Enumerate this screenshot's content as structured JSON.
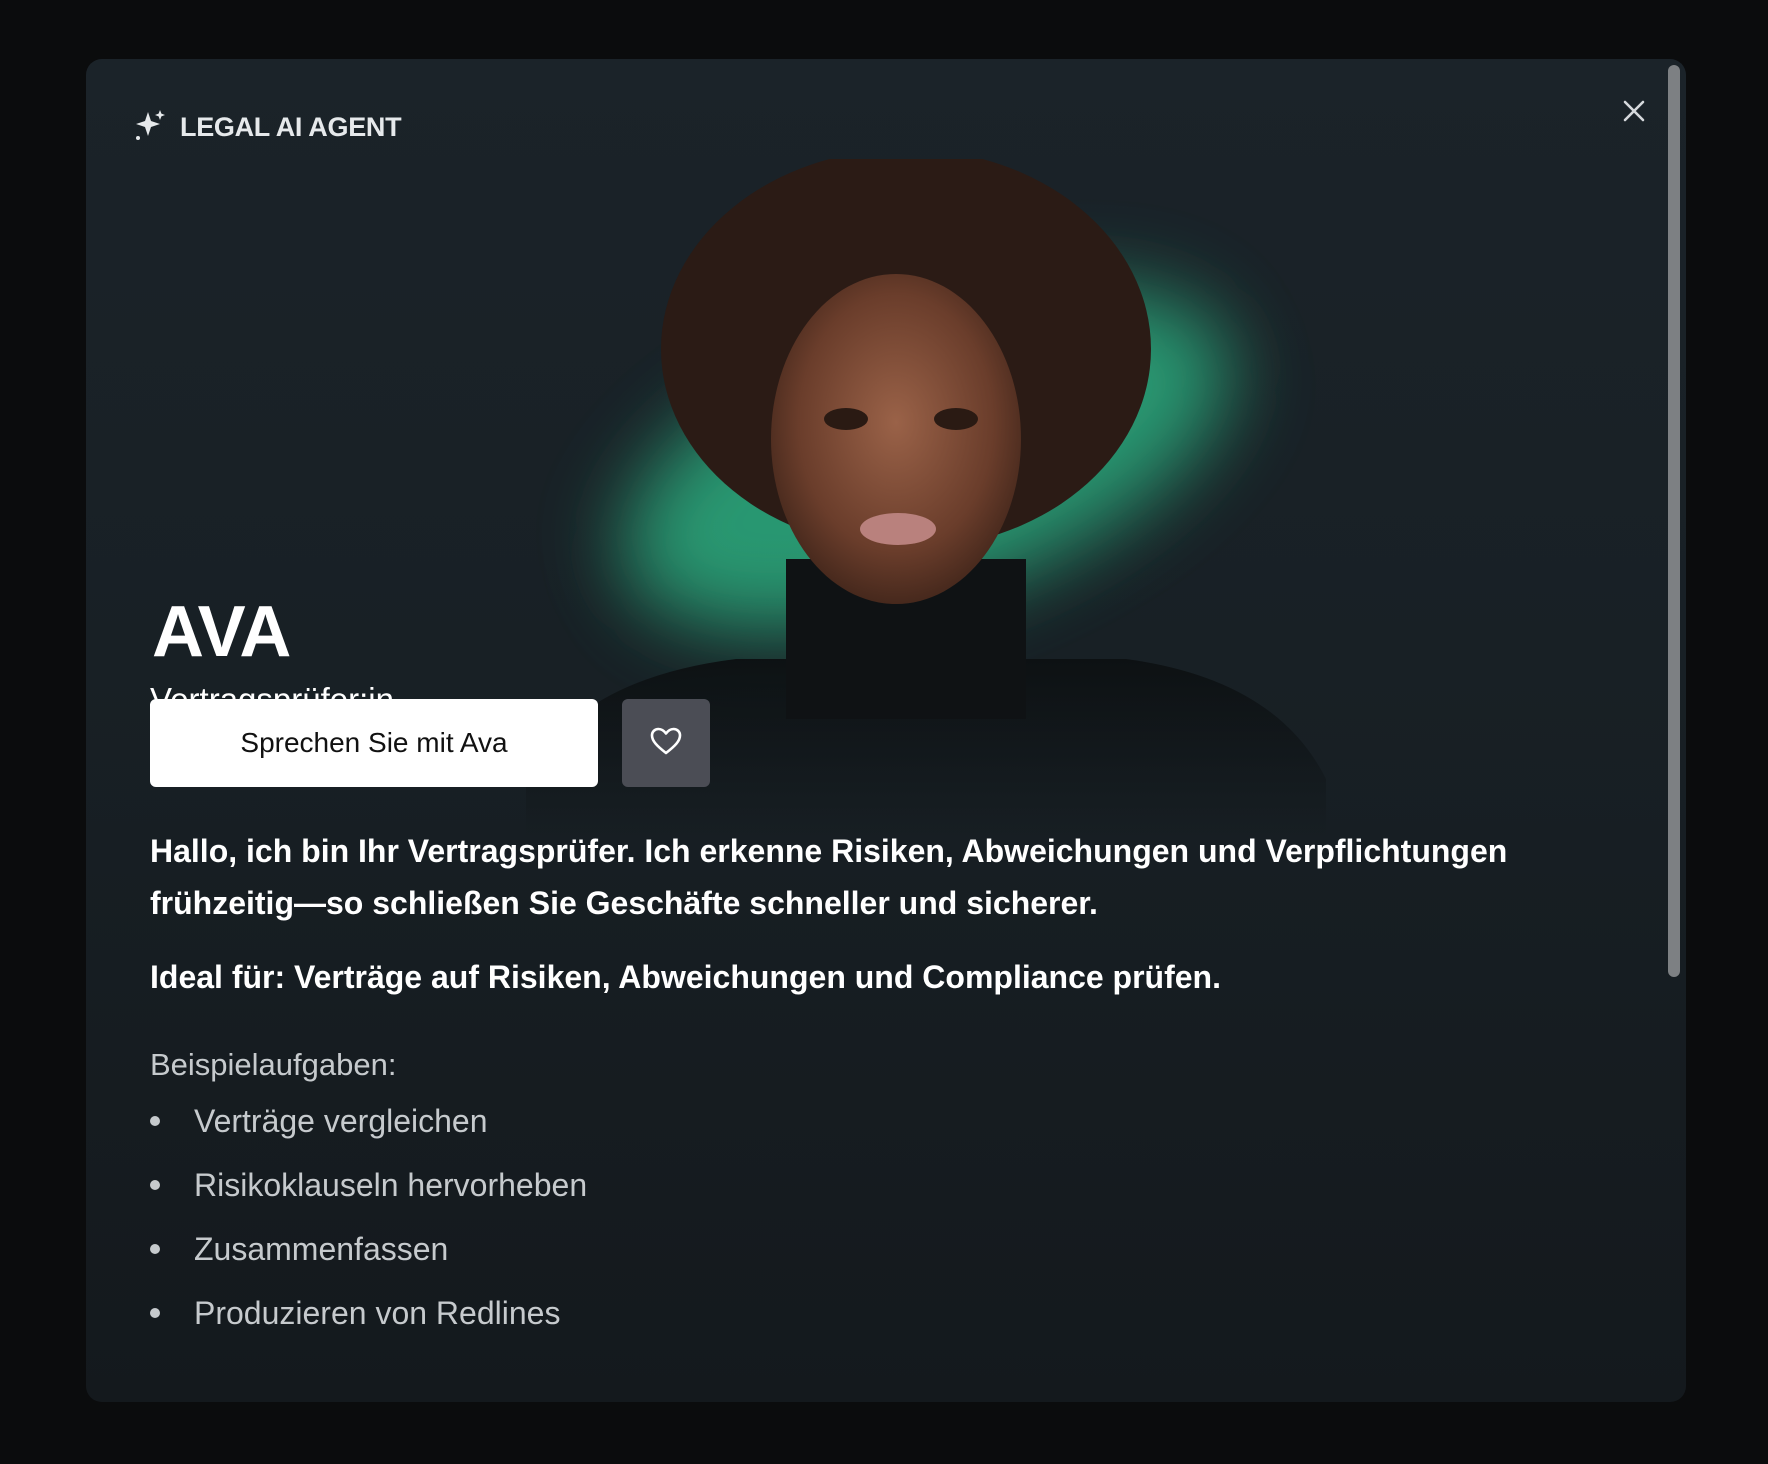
{
  "header": {
    "badge_label": "LEGAL AI AGENT"
  },
  "agent": {
    "name": "AVA",
    "role": "Vertragsprüfer:in",
    "cta_label": "Sprechen Sie mit Ava",
    "intro": "Hallo, ich bin Ihr Vertragsprüfer. Ich erkenne Risiken, Abweichungen und Verpflichtungen frühzeitig—so schließen Sie Geschäfte schneller und sicherer.",
    "ideal_for": "Ideal für: Verträge auf Risiken, Abweichungen und Compliance prüfen.",
    "examples_title": "Beispielaufgaben:",
    "examples": [
      "Verträge vergleichen",
      "Risikoklauseln hervorheben",
      "Zusammenfassen",
      "Produzieren von Redlines"
    ]
  },
  "icons": {
    "badge": "sparkle-icon",
    "close": "close-icon",
    "favorite": "heart-icon"
  },
  "colors": {
    "page_background": "#0b0c0d",
    "modal_background": "#1b2329",
    "glow": "#2fbf8a",
    "primary_button": "#ffffff",
    "secondary_button": "#4b4d55",
    "muted_text": "#c6cacd"
  }
}
